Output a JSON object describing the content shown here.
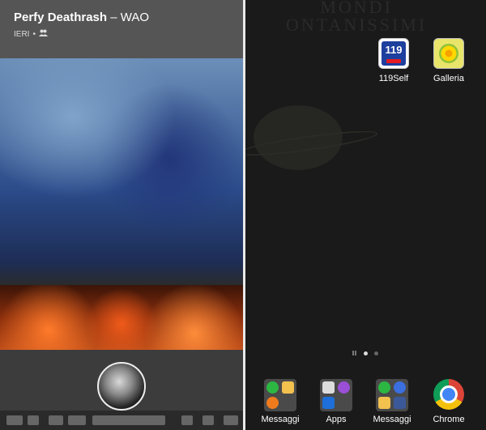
{
  "left": {
    "post": {
      "author": "Perfy Deathrash",
      "separator": "–",
      "title": "WAO",
      "time": "IERI",
      "dot": "•",
      "audience_icon": "friends-icon"
    }
  },
  "right": {
    "wallpaper_text": "MONDI\nONTANISSIMI",
    "apps": [
      {
        "label": "119Self",
        "icon": "tim-119-icon"
      },
      {
        "label": "Galleria",
        "icon": "gallery-icon"
      }
    ],
    "dock": [
      {
        "label": "Messaggi",
        "icon": "folder-icon"
      },
      {
        "label": "Apps",
        "icon": "folder-icon"
      },
      {
        "label": "Messaggi",
        "icon": "folder-icon"
      },
      {
        "label": "Chrome",
        "icon": "chrome-icon"
      }
    ]
  }
}
